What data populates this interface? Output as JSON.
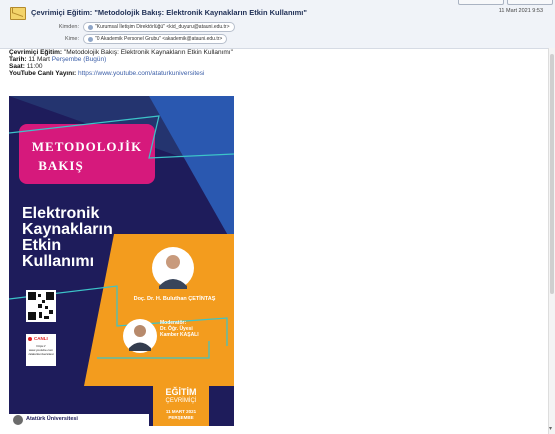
{
  "email": {
    "subject": "Çevrimiçi Eğitim: \"Metodolojik Bakış: Elektronik Kaynakların Etkin Kullanımı\"",
    "date": "11 Mart 2021 9:53",
    "from_label": "Kimden:",
    "from_value": "\"Kurumsal İletişim Direktörlüğü\" <kid_duyuru@atauni.edu.tr>",
    "to_label": "Kime:",
    "to_value": "\"0 Akademik Personel Grubu\" <akademik@atauni.edu.tr>"
  },
  "body": {
    "line1_label": "Çevrimiçi Eğitim:",
    "line1_value": "\"Metodolojik Bakış: Elektronik Kaynakların Etkin Kullanımı\"",
    "line2_label": "Tarih:",
    "line2_value": "11 Mart",
    "line2_link": "Perşembe (Bugün)",
    "line3_label": "Saat:",
    "line3_value": "11:00",
    "line4_label": "YouTube Canlı Yayını:",
    "line4_link": "https://www.youtube.com/ataturkuniversitesi"
  },
  "poster": {
    "title1": "METODOLOJİK",
    "title2": "BAKIŞ",
    "heading1": "Elektronik",
    "heading2": "Kaynakların",
    "heading3": "Etkin",
    "heading4": "Kullanımı",
    "speaker": "Doç. Dr. H. Buluthan ÇETİNTAŞ",
    "moderator_label": "Moderatör:",
    "moderator_title": "Dr. Öğr. Üyesi",
    "moderator_name": "Kamber KAŞALI",
    "live_label": "CANLI",
    "live_url1": "https://",
    "live_url2": "www.youtube.com",
    "live_url3": "/ataturkuniversitesi",
    "badge1": "EĞİTİM",
    "badge2": "ÇEVRİMİÇİ",
    "badge3": "11 MART 2021",
    "badge4": "PERŞEMBE",
    "university": "Atatürk Üniversitesi"
  },
  "colors": {
    "poster_navy": "#1e1c5b",
    "poster_pink": "#d6197c",
    "poster_orange": "#f39c1e",
    "poster_teal": "#3cc4c8",
    "link": "#3b5ea8"
  }
}
